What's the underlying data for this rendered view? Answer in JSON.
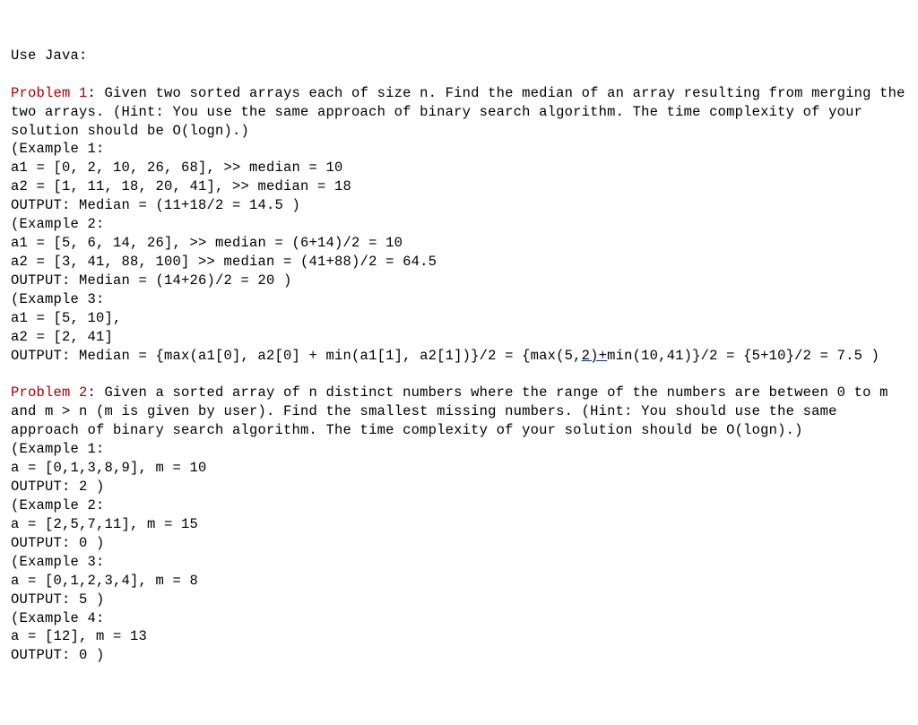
{
  "intro": "Use Java:",
  "p1": {
    "heading_label": "Problem 1",
    "desc": ": Given two sorted arrays each of size n. Find the median of an array resulting from merging the two arrays. (Hint: You use the same approach of binary search algorithm. The time complexity of your solution should be O(logn).)",
    "ex1": {
      "label": "(Example 1:",
      "a1": "a1 = [0, 2, 10, 26, 68], >> median = 10",
      "a2": "a2 = [1, 11, 18, 20, 41], >> median = 18",
      "out": "OUTPUT: Median = (11+18/2 = 14.5 )"
    },
    "ex2": {
      "label": "(Example 2:",
      "a1": "a1 = [5, 6, 14, 26], >> median = (6+14)/2 = 10",
      "a2": "a2 = [3, 41, 88, 100] >> median = (41+88)/2 = 64.5",
      "out": "OUTPUT: Median = (14+26)/2 = 20 )"
    },
    "ex3": {
      "label": "(Example 3:",
      "a1": "a1 = [5, 10],",
      "a2": "a2 = [2, 41]",
      "out_prefix": "OUTPUT: Median = {max(a1[0], a2[0] + min(a1[1], a2[1])}/2 = {max(5,",
      "out_mid": "2)+",
      "out_suffix": "min(10,41)}/2 = {5+10}/2 = 7.5 )"
    }
  },
  "p2": {
    "heading_label": "Problem 2",
    "desc": ": Given a sorted array of n distinct numbers where the range of the numbers are between 0 to m and m > n (m is given by user). Find the smallest missing numbers. (Hint: You should use the same approach of binary search algorithm. The time complexity of your solution should be O(logn).)",
    "ex1": {
      "label": "(Example 1:",
      "a": "a = [0,1,3,8,9], m = 10",
      "out": "OUTPUT: 2 )"
    },
    "ex2": {
      "label": "(Example 2:",
      "a": "a = [2,5,7,11], m = 15",
      "out": "OUTPUT: 0 )"
    },
    "ex3": {
      "label": "(Example 3:",
      "a": "a = [0,1,2,3,4], m = 8",
      "out": "OUTPUT: 5 )"
    },
    "ex4": {
      "label": "(Example 4:",
      "a": "a = [12], m = 13",
      "out": "OUTPUT: 0 )"
    }
  }
}
